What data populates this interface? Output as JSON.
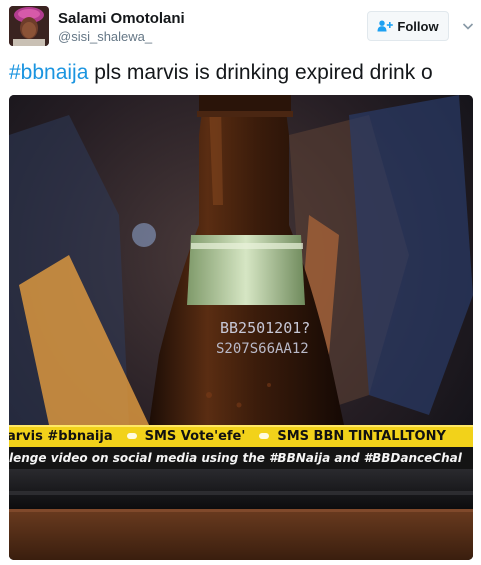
{
  "author": {
    "display_name": "Salami Omotolani",
    "handle": "@sisi_shalewa_",
    "avatar_icon": "avatar-photo-icon"
  },
  "actions": {
    "follow_label": "Follow",
    "follow_icon": "add-user-icon",
    "menu_icon": "chevron-down-icon"
  },
  "tweet": {
    "hashtag": "#bbnaija",
    "body": " pls marvis is drinking expired drink o"
  },
  "media": {
    "bottle_label_line1": "BB2501201?",
    "bottle_label_line2": "S207S66AA12",
    "ticker_line1_items": [
      "arvis #bbnaija",
      "SMS Vote'efe'",
      "SMS BBN TINTALLTONY"
    ],
    "ticker_line2": "lenge video on social media using the #BBNaija and #BBDanceChal"
  },
  "colors": {
    "hashtag_blue": "#1b95e0",
    "ticker_yellow": "#f2d21a",
    "ticker_dark": "#141414",
    "handle_gray": "#657786"
  }
}
